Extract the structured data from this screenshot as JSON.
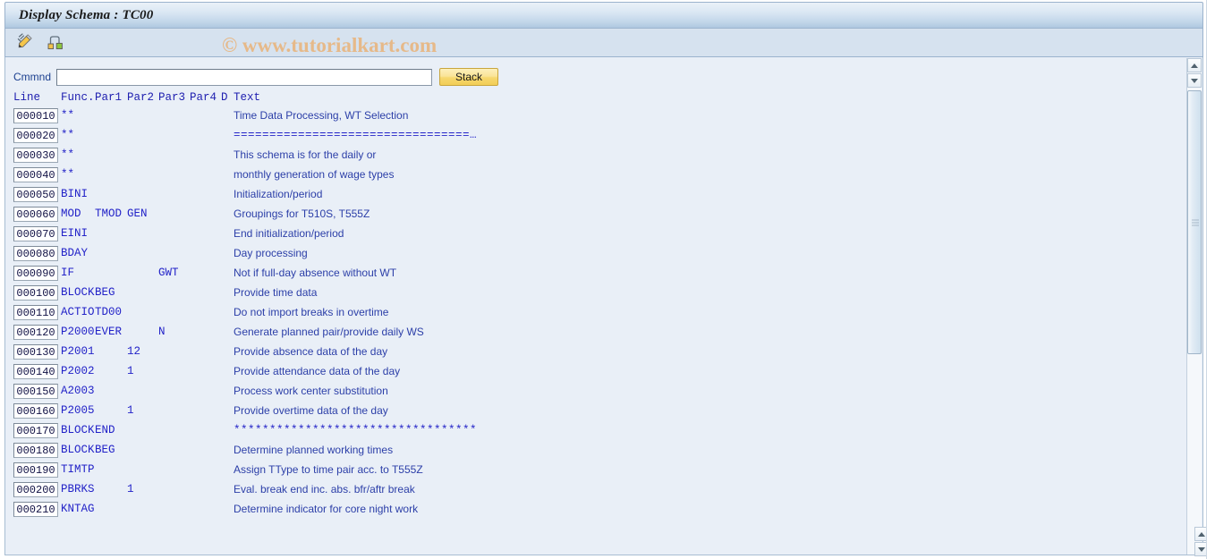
{
  "window": {
    "title": "Display Schema : TC00"
  },
  "watermark": "© www.tutorialkart.com",
  "toolbar": {
    "items": [
      {
        "name": "edit-schema-icon",
        "tooltip": "Display <-> Change"
      },
      {
        "name": "schema-structure-icon",
        "tooltip": "Structure Display"
      }
    ]
  },
  "command": {
    "label": "Cmmnd",
    "value": "",
    "placeholder": "",
    "stack_label": "Stack"
  },
  "grid": {
    "headers": {
      "line": "Line",
      "func": "Func.",
      "par1": "Par1",
      "par2": "Par2",
      "par3": "Par3",
      "par4": "Par4",
      "d": "D",
      "text": "Text"
    },
    "rows": [
      {
        "line": "000010",
        "func": "**",
        "par1": "",
        "par2": "",
        "par3": "",
        "par4": "",
        "d": "",
        "text": "Time Data Processing, WT Selection",
        "symbols": false
      },
      {
        "line": "000020",
        "func": "**",
        "par1": "",
        "par2": "",
        "par3": "",
        "par4": "",
        "d": "",
        "text": "=================================…",
        "symbols": true
      },
      {
        "line": "000030",
        "func": "**",
        "par1": "",
        "par2": "",
        "par3": "",
        "par4": "",
        "d": "",
        "text": "This schema is for the daily or",
        "symbols": false
      },
      {
        "line": "000040",
        "func": "**",
        "par1": "",
        "par2": "",
        "par3": "",
        "par4": "",
        "d": "",
        "text": "monthly generation of wage types",
        "symbols": false
      },
      {
        "line": "000050",
        "func": "BINI",
        "par1": "",
        "par2": "",
        "par3": "",
        "par4": "",
        "d": "",
        "text": "Initialization/period",
        "symbols": false
      },
      {
        "line": "000060",
        "func": "MOD",
        "par1": "TMOD",
        "par2": "GEN",
        "par3": "",
        "par4": "",
        "d": "",
        "text": "Groupings for T510S, T555Z",
        "symbols": false
      },
      {
        "line": "000070",
        "func": "EINI",
        "par1": "",
        "par2": "",
        "par3": "",
        "par4": "",
        "d": "",
        "text": "End initialization/period",
        "symbols": false
      },
      {
        "line": "000080",
        "func": "BDAY",
        "par1": "",
        "par2": "",
        "par3": "",
        "par4": "",
        "d": "",
        "text": "Day processing",
        "symbols": false
      },
      {
        "line": "000090",
        "func": "IF",
        "par1": "",
        "par2": "",
        "par3": "GWT",
        "par4": "",
        "d": "",
        "text": "Not if full-day absence without WT",
        "symbols": false
      },
      {
        "line": "000100",
        "func": "BLOCK",
        "par1": "BEG",
        "par2": "",
        "par3": "",
        "par4": "",
        "d": "",
        "text": "Provide time data",
        "symbols": false
      },
      {
        "line": "000110",
        "func": "ACTIO",
        "par1": "TD00",
        "par2": "",
        "par3": "",
        "par4": "",
        "d": "",
        "text": "Do not import breaks in overtime",
        "symbols": false
      },
      {
        "line": "000120",
        "func": "P2000",
        "par1": "EVER",
        "par2": "",
        "par3": "N",
        "par4": "",
        "d": "",
        "text": "Generate planned pair/provide daily WS",
        "symbols": false
      },
      {
        "line": "000130",
        "func": "P2001",
        "par1": "",
        "par2": "12",
        "par3": "",
        "par4": "",
        "d": "",
        "text": "Provide absence data of the day",
        "symbols": false
      },
      {
        "line": "000140",
        "func": "P2002",
        "par1": "",
        "par2": "1",
        "par3": "",
        "par4": "",
        "d": "",
        "text": "Provide attendance data of the day",
        "symbols": false
      },
      {
        "line": "000150",
        "func": "A2003",
        "par1": "",
        "par2": "",
        "par3": "",
        "par4": "",
        "d": "",
        "text": "Process work center substitution",
        "symbols": false
      },
      {
        "line": "000160",
        "func": "P2005",
        "par1": "",
        "par2": "1",
        "par3": "",
        "par4": "",
        "d": "",
        "text": "Provide overtime data of the day",
        "symbols": false
      },
      {
        "line": "000170",
        "func": "BLOCK",
        "par1": "END",
        "par2": "",
        "par3": "",
        "par4": "",
        "d": "",
        "text": "**********************************",
        "symbols": true
      },
      {
        "line": "000180",
        "func": "BLOCK",
        "par1": "BEG",
        "par2": "",
        "par3": "",
        "par4": "",
        "d": "",
        "text": "Determine planned working times",
        "symbols": false
      },
      {
        "line": "000190",
        "func": "TIMTP",
        "par1": "",
        "par2": "",
        "par3": "",
        "par4": "",
        "d": "",
        "text": "Assign TType to time pair acc. to T555Z",
        "symbols": false
      },
      {
        "line": "000200",
        "func": "PBRKS",
        "par1": "",
        "par2": "1",
        "par3": "",
        "par4": "",
        "d": "",
        "text": "Eval. break end inc. abs. bfr/aftr break",
        "symbols": false
      },
      {
        "line": "000210",
        "func": "KNTAG",
        "par1": "",
        "par2": "",
        "par3": "",
        "par4": "",
        "d": "",
        "text": "Determine indicator for core night work",
        "symbols": false
      }
    ]
  },
  "scrollbar": {
    "up_arrow": "▲",
    "down_arrow": "▼"
  },
  "colors": {
    "title_bar_start": "#eaf1f8",
    "title_bar_end": "#aec8e0",
    "toolbar_bg": "#d6e2ef",
    "workarea_bg": "#e9eff7",
    "grid_text": "#2323c8",
    "description_text": "#2c3fa8",
    "header_text": "#2020b0",
    "command_label": "#1b3f8f",
    "stack_button": "#f6d86f",
    "watermark": "#e6b989"
  }
}
